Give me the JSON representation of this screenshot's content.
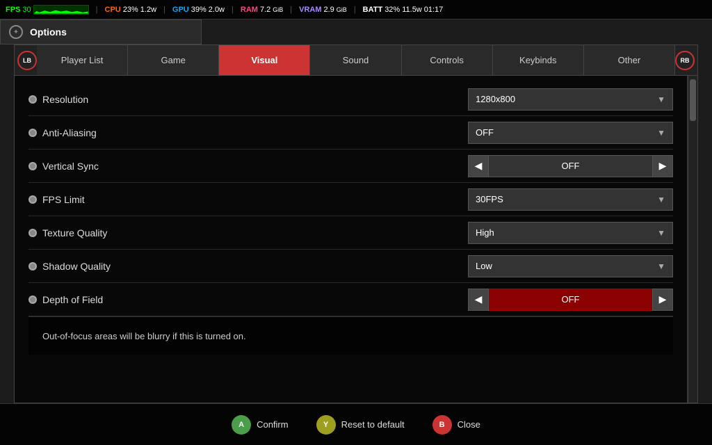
{
  "hud": {
    "fps_label": "FPS",
    "fps_value": "30",
    "cpu_label": "CPU",
    "cpu_pct": "23%",
    "cpu_watts": "1.2w",
    "gpu_label": "GPU",
    "gpu_pct": "39%",
    "gpu_watts": "2.0w",
    "ram_label": "RAM",
    "ram_value": "7.2",
    "ram_unit": "GiB",
    "vram_label": "VRAM",
    "vram_value": "2.9",
    "vram_unit": "GiB",
    "batt_label": "BATT",
    "batt_pct": "32%",
    "batt_watts": "11.5w",
    "batt_time": "01:17"
  },
  "options_title": "Options",
  "tabs": {
    "lb": "LB",
    "rb": "RB",
    "items": [
      {
        "id": "player-list",
        "label": "Player List",
        "active": false
      },
      {
        "id": "game",
        "label": "Game",
        "active": false
      },
      {
        "id": "visual",
        "label": "Visual",
        "active": true
      },
      {
        "id": "sound",
        "label": "Sound",
        "active": false
      },
      {
        "id": "controls",
        "label": "Controls",
        "active": false
      },
      {
        "id": "keybinds",
        "label": "Keybinds",
        "active": false
      },
      {
        "id": "other",
        "label": "Other",
        "active": false
      }
    ]
  },
  "settings": [
    {
      "id": "resolution",
      "label": "Resolution",
      "type": "dropdown",
      "value": "1280x800"
    },
    {
      "id": "anti-aliasing",
      "label": "Anti-Aliasing",
      "type": "dropdown",
      "value": "OFF"
    },
    {
      "id": "vertical-sync",
      "label": "Vertical Sync",
      "type": "arrows",
      "value": "OFF"
    },
    {
      "id": "fps-limit",
      "label": "FPS Limit",
      "type": "dropdown",
      "value": "30FPS"
    },
    {
      "id": "texture-quality",
      "label": "Texture Quality",
      "type": "dropdown",
      "value": "High"
    },
    {
      "id": "shadow-quality",
      "label": "Shadow Quality",
      "type": "dropdown",
      "value": "Low"
    },
    {
      "id": "depth-of-field",
      "label": "Depth of Field",
      "type": "arrows-highlight",
      "value": "OFF"
    }
  ],
  "info_text": "Out-of-focus areas will be blurry if this is turned on.",
  "actions": {
    "confirm": "Confirm",
    "reset": "Reset to default",
    "close": "Close",
    "confirm_btn": "A",
    "reset_btn": "Y",
    "close_btn": "B"
  }
}
